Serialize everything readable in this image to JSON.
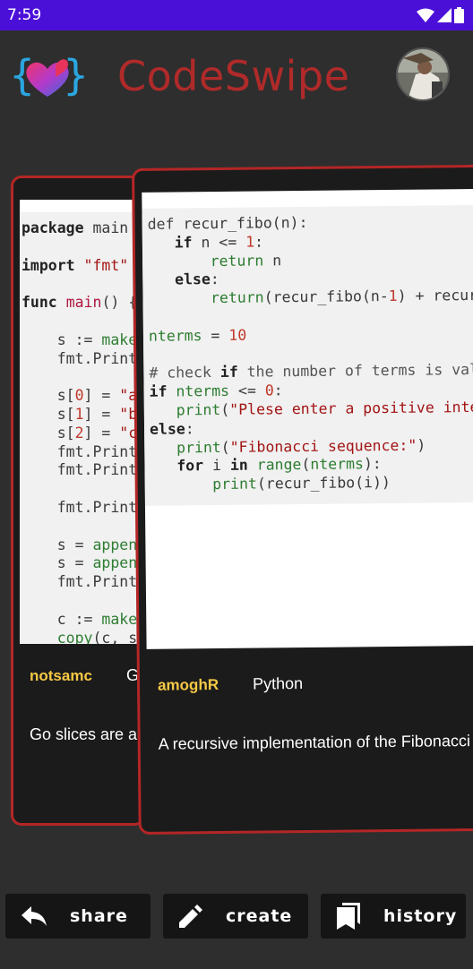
{
  "status_bar": {
    "time": "7:59"
  },
  "app": {
    "title": "CodeSwipe"
  },
  "cards": {
    "back": {
      "username": "notsamc",
      "language": "Go",
      "description": "Go slices are a"
    },
    "front": {
      "username": "amoghR",
      "language": "Python",
      "description": "A recursive implementation of the Fibonacci sequence"
    }
  },
  "actions": {
    "share_label": "share",
    "create_label": "create",
    "history_label": "history"
  },
  "colors": {
    "status_bar": "#4b10d8",
    "title": "#b02a2a",
    "card_border": "#b42626",
    "username": "#f6c945"
  }
}
